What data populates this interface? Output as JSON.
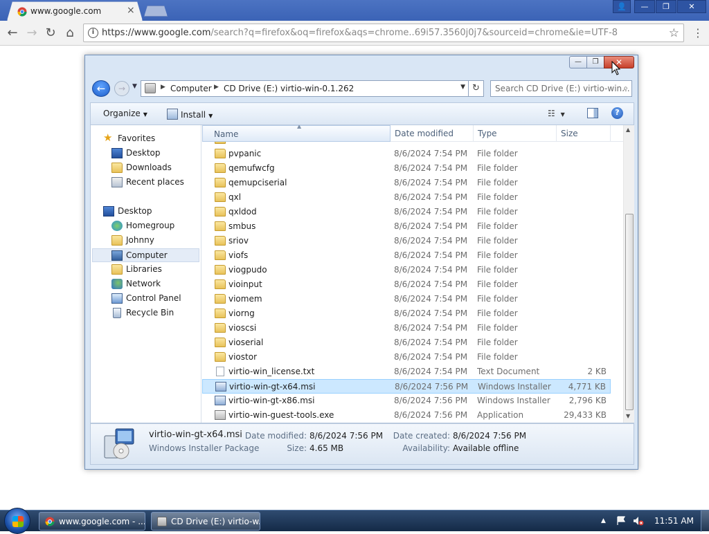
{
  "browser": {
    "tab_title": "www.google.com",
    "tab_close": "×",
    "url_host": "https://www.google.com",
    "url_rest": "/search?q=firefox&oq=firefox&aqs=chrome..69i57.3560j0j7&sourceid=chrome&ie=UTF-8",
    "winctrls": {
      "user": "👤",
      "min": "—",
      "max": "❐",
      "close": "✕"
    },
    "nav": {
      "back": "←",
      "forward": "→",
      "reload": "↻",
      "home": "⌂",
      "star": "☆",
      "menu": "⋮",
      "info": "i"
    }
  },
  "explorer": {
    "caption": {
      "min": "—",
      "max": "❐",
      "close": "✕"
    },
    "breadcrumb": [
      "Computer",
      "CD Drive (E:) virtio-win-0.1.262"
    ],
    "search_placeholder": "Search CD Drive (E:) virtio-win...",
    "toolbar": {
      "organize": "Organize",
      "install": "Install",
      "help": "?"
    },
    "nav_pane": {
      "favorites_header": "Favorites",
      "favorites": [
        "Desktop",
        "Downloads",
        "Recent places"
      ],
      "desktop_header": "Desktop",
      "desktop_items": [
        "Homegroup",
        "Johnny",
        "Computer",
        "Libraries",
        "Network",
        "Control Panel",
        "Recycle Bin"
      ],
      "selected": "Computer"
    },
    "columns": {
      "name": "Name",
      "date": "Date modified",
      "type": "Type",
      "size": "Size"
    },
    "files": [
      {
        "name": "pvpanic",
        "date": "8/6/2024 7:54 PM",
        "type": "File folder",
        "size": "",
        "kind": "folder"
      },
      {
        "name": "qemufwcfg",
        "date": "8/6/2024 7:54 PM",
        "type": "File folder",
        "size": "",
        "kind": "folder"
      },
      {
        "name": "qemupciserial",
        "date": "8/6/2024 7:54 PM",
        "type": "File folder",
        "size": "",
        "kind": "folder"
      },
      {
        "name": "qxl",
        "date": "8/6/2024 7:54 PM",
        "type": "File folder",
        "size": "",
        "kind": "folder"
      },
      {
        "name": "qxldod",
        "date": "8/6/2024 7:54 PM",
        "type": "File folder",
        "size": "",
        "kind": "folder"
      },
      {
        "name": "smbus",
        "date": "8/6/2024 7:54 PM",
        "type": "File folder",
        "size": "",
        "kind": "folder"
      },
      {
        "name": "sriov",
        "date": "8/6/2024 7:54 PM",
        "type": "File folder",
        "size": "",
        "kind": "folder"
      },
      {
        "name": "viofs",
        "date": "8/6/2024 7:54 PM",
        "type": "File folder",
        "size": "",
        "kind": "folder"
      },
      {
        "name": "viogpudo",
        "date": "8/6/2024 7:54 PM",
        "type": "File folder",
        "size": "",
        "kind": "folder"
      },
      {
        "name": "vioinput",
        "date": "8/6/2024 7:54 PM",
        "type": "File folder",
        "size": "",
        "kind": "folder"
      },
      {
        "name": "viomem",
        "date": "8/6/2024 7:54 PM",
        "type": "File folder",
        "size": "",
        "kind": "folder"
      },
      {
        "name": "viorng",
        "date": "8/6/2024 7:54 PM",
        "type": "File folder",
        "size": "",
        "kind": "folder"
      },
      {
        "name": "vioscsi",
        "date": "8/6/2024 7:54 PM",
        "type": "File folder",
        "size": "",
        "kind": "folder"
      },
      {
        "name": "vioserial",
        "date": "8/6/2024 7:54 PM",
        "type": "File folder",
        "size": "",
        "kind": "folder"
      },
      {
        "name": "viostor",
        "date": "8/6/2024 7:54 PM",
        "type": "File folder",
        "size": "",
        "kind": "folder"
      },
      {
        "name": "virtio-win_license.txt",
        "date": "8/6/2024 7:54 PM",
        "type": "Text Document",
        "size": "2 KB",
        "kind": "txt"
      },
      {
        "name": "virtio-win-gt-x64.msi",
        "date": "8/6/2024 7:56 PM",
        "type": "Windows Installer ...",
        "size": "4,771 KB",
        "kind": "msi",
        "selected": true
      },
      {
        "name": "virtio-win-gt-x86.msi",
        "date": "8/6/2024 7:56 PM",
        "type": "Windows Installer ...",
        "size": "2,796 KB",
        "kind": "msi"
      },
      {
        "name": "virtio-win-guest-tools.exe",
        "date": "8/6/2024 7:56 PM",
        "type": "Application",
        "size": "29,433 KB",
        "kind": "exe"
      }
    ],
    "details": {
      "name": "virtio-win-gt-x64.msi",
      "kind": "Windows Installer Package",
      "date_modified_label": "Date modified:",
      "date_modified": "8/6/2024 7:56 PM",
      "size_label": "Size:",
      "size": "4.65 MB",
      "date_created_label": "Date created:",
      "date_created": "8/6/2024 7:56 PM",
      "availability_label": "Availability:",
      "availability": "Available offline"
    }
  },
  "taskbar": {
    "items": [
      "www.google.com - ...",
      "CD Drive (E:) virtio-w..."
    ],
    "tray_expand": "▲",
    "clock": "11:51 AM"
  }
}
